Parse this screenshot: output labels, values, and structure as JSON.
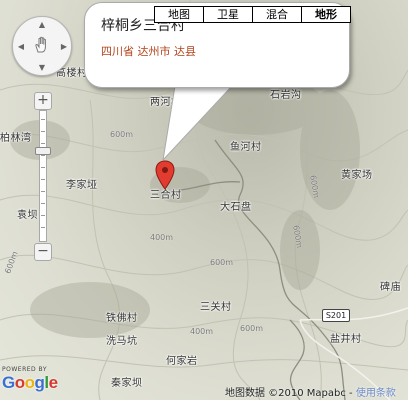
{
  "map_types": [
    "地图",
    "卫星",
    "混合",
    "地形"
  ],
  "active_map_type": "地形",
  "info_window": {
    "title": "梓桐乡三合村",
    "address": "四川省 达州市 达县"
  },
  "places": [
    "高楼村",
    "两河村",
    "石岩沟",
    "柏林湾",
    "鱼河村",
    "李家垭",
    "黄家场",
    "三合村",
    "袁坝",
    "大石盘",
    "碑庙",
    "三关村",
    "铁佛村",
    "洗马坑",
    "何家岩",
    "秦家坝",
    "盐井村"
  ],
  "contours": [
    "600m",
    "600m",
    "400m",
    "600m",
    "600m",
    "600m",
    "400m",
    "600m"
  ],
  "road_shield": "S201",
  "attribution": {
    "powered_by": "POWERED BY",
    "logo": "Google",
    "copyright": "地图数据 ©2010 Mapabc - ",
    "terms": "使用条款"
  },
  "zoom": {
    "plus": "+",
    "minus": "−",
    "level_fraction": 0.3
  },
  "pan": {
    "up": "▲",
    "down": "▼",
    "left": "◀",
    "right": "▶",
    "center_icon": "hand-icon"
  }
}
